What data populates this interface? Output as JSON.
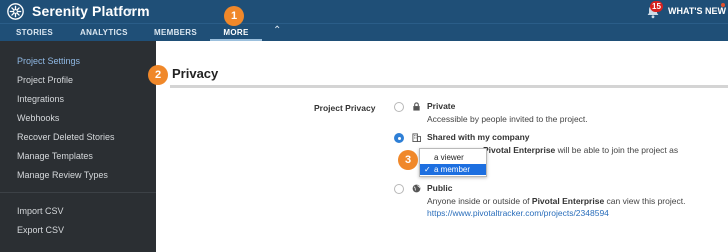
{
  "header": {
    "title": "Serenity Platform",
    "notification_count": "15",
    "whats_new": "WHAT'S NEW"
  },
  "nav": {
    "tabs": [
      {
        "label": "STORIES"
      },
      {
        "label": "ANALYTICS"
      },
      {
        "label": "MEMBERS"
      },
      {
        "label": "MORE",
        "active": true
      }
    ]
  },
  "sidebar": {
    "items": [
      {
        "label": "Project Settings",
        "active": true
      },
      {
        "label": "Project Profile"
      },
      {
        "label": "Integrations"
      },
      {
        "label": "Webhooks"
      },
      {
        "label": "Recover Deleted Stories"
      },
      {
        "label": "Manage Templates"
      },
      {
        "label": "Manage Review Types"
      }
    ],
    "footer_items": [
      {
        "label": "Import CSV"
      },
      {
        "label": "Export CSV"
      }
    ]
  },
  "main": {
    "section_title": "Privacy",
    "field_label": "Project Privacy",
    "options": {
      "private": {
        "title": "Private",
        "description": "Accessible by people invited to the project.",
        "selected": false
      },
      "company": {
        "title": "Shared with my company",
        "desc_before": "",
        "desc_bold": "Pivotal Enterprise",
        "desc_after": " will be able to join the project as",
        "selected": true
      },
      "public": {
        "title": "Public",
        "desc_before": "Anyone inside or outside of ",
        "desc_bold": "Pivotal Enterprise",
        "desc_after": " can view this project.",
        "link": "https://www.pivotaltracker.com/projects/2348594",
        "selected": false
      }
    },
    "role_dropdown": {
      "options": [
        {
          "label": "a viewer",
          "selected": false
        },
        {
          "label": "a member",
          "selected": true
        }
      ]
    }
  },
  "callouts": [
    "1",
    "2",
    "3"
  ],
  "colors": {
    "header_bg": "#1f4f77",
    "sidebar_bg": "#2b2f33",
    "sidebar_active": "#8fb8e3",
    "radio_checked": "#2e7fd6",
    "dropdown_selected": "#1d6fe0",
    "callout": "#f0882a",
    "link": "#2a6ebb"
  }
}
